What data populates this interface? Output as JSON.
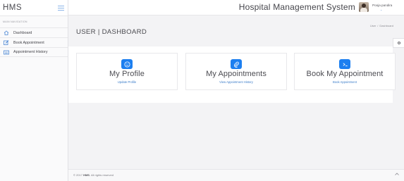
{
  "brand": {
    "name": "HMS"
  },
  "header": {
    "app_title": "Hospital Management System",
    "user_name": "Pooja pandira"
  },
  "sidebar": {
    "heading": "MAIN NAVIGATION",
    "items": [
      {
        "label": "Dashboard",
        "icon": "home-icon"
      },
      {
        "label": "Book Appointment",
        "icon": "edit-icon"
      },
      {
        "label": "Appointment History",
        "icon": "list-icon"
      }
    ]
  },
  "page": {
    "title": "USER | DASHBOARD",
    "breadcrumb": [
      "User",
      "Dashboard"
    ]
  },
  "cards": [
    {
      "title": "My Profile",
      "link": "Update Profile",
      "icon": "smile-icon"
    },
    {
      "title": "My Appointments",
      "link": "View Appointment History",
      "icon": "paperclip-icon"
    },
    {
      "title": "Book My Appointment",
      "link": "Book Appointment",
      "icon": "terminal-icon"
    }
  ],
  "footer": {
    "prefix": "© 2017 ",
    "brand": "HMS",
    "suffix": ". All rights reserved"
  },
  "colors": {
    "accent": "#1c7ff0",
    "link": "#3a7cc9"
  }
}
